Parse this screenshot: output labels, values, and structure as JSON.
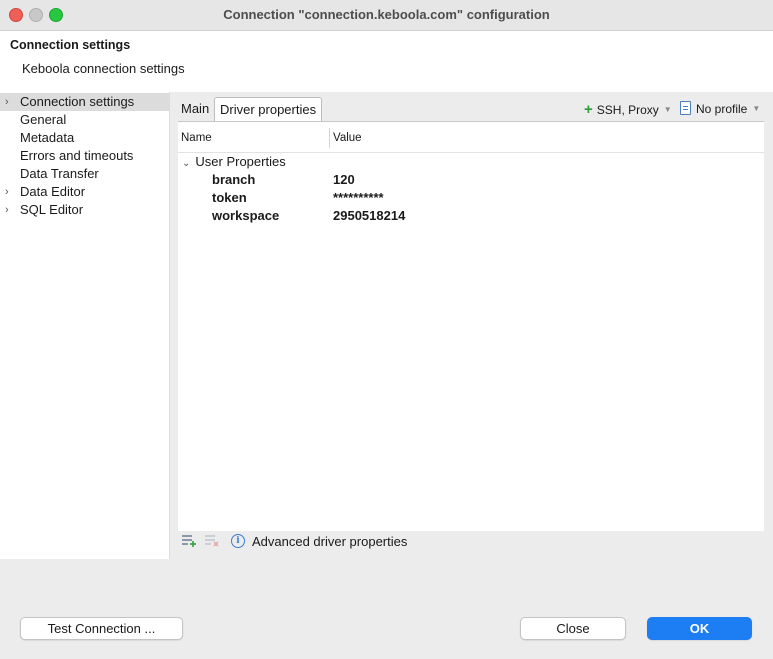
{
  "window": {
    "title": "Connection \"connection.keboola.com\" configuration"
  },
  "header": {
    "title": "Connection settings",
    "description": "Keboola connection settings"
  },
  "tree": {
    "items": [
      {
        "label": "Connection settings",
        "expandable": true,
        "selected": true
      },
      {
        "label": "General",
        "expandable": false
      },
      {
        "label": "Metadata",
        "expandable": false
      },
      {
        "label": "Errors and timeouts",
        "expandable": false
      },
      {
        "label": "Data Transfer",
        "expandable": false
      },
      {
        "label": "Data Editor",
        "expandable": true
      },
      {
        "label": "SQL Editor",
        "expandable": true
      }
    ]
  },
  "tabs": [
    {
      "label": "Main",
      "active": false
    },
    {
      "label": "Driver properties",
      "active": true
    }
  ],
  "toolbar": {
    "ssh_label": "SSH, Proxy",
    "profile_label": "No profile"
  },
  "table": {
    "columns": [
      "Name",
      "Value"
    ],
    "group_label": "User Properties",
    "rows": [
      {
        "name": "branch",
        "value": "120"
      },
      {
        "name": "token",
        "value": "**********"
      },
      {
        "name": "workspace",
        "value": "2950518214"
      }
    ]
  },
  "bottom": {
    "advanced_label": "Advanced driver properties"
  },
  "buttons": {
    "test": "Test Connection ...",
    "close": "Close",
    "ok": "OK"
  },
  "colors": {
    "accent": "#1d7df2",
    "add_icon": "#2e9e3a",
    "info_icon": "#3b7bd4"
  },
  "icons": {
    "add_property": "add-property-icon",
    "remove_property": "remove-property-icon",
    "info": "info-icon",
    "plus": "plus-icon",
    "profile": "document-icon"
  }
}
